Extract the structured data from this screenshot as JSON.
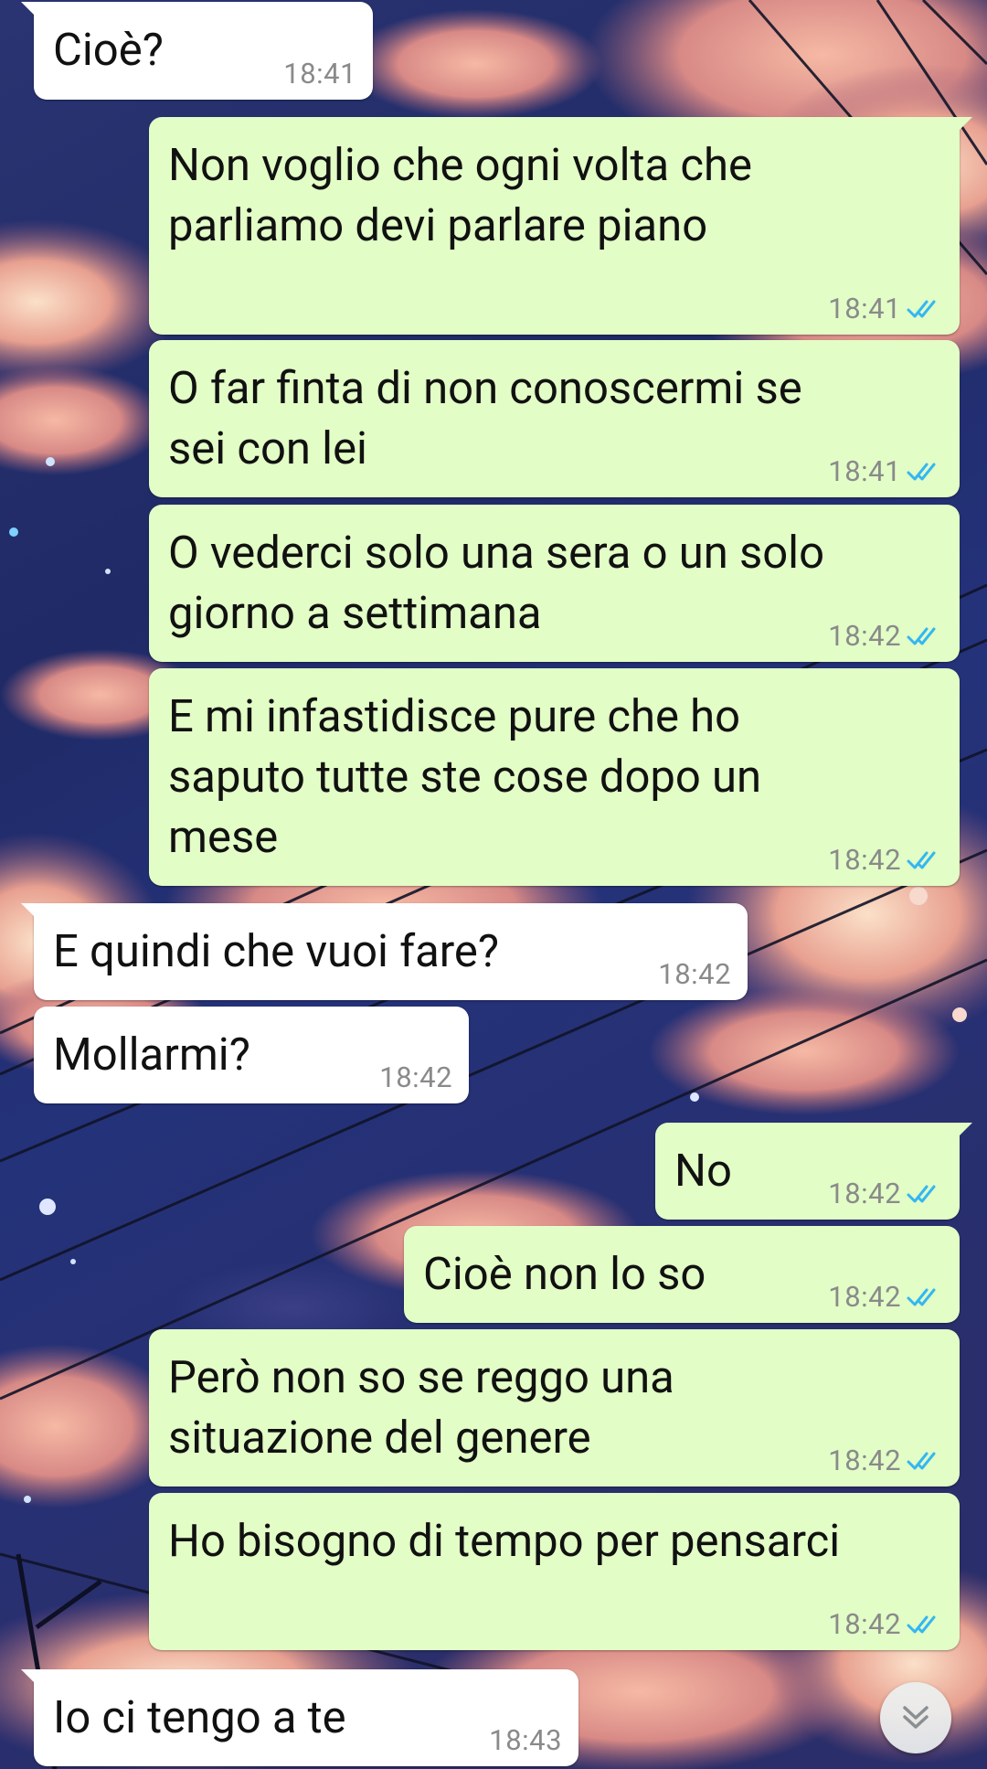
{
  "chat": {
    "messages": [
      {
        "dir": "in",
        "text": "Cioè?",
        "time": "18:41",
        "read": false
      },
      {
        "dir": "out",
        "text": "Non voglio che ogni volta che\nparliamo devi parlare piano",
        "time": "18:41",
        "read": true
      },
      {
        "dir": "out",
        "text": "O far finta di non conoscermi se\nsei con lei",
        "time": "18:41",
        "read": true
      },
      {
        "dir": "out",
        "text": "O vederci solo una sera o un solo\ngiorno a settimana",
        "time": "18:42",
        "read": true
      },
      {
        "dir": "out",
        "text": "E mi infastidisce pure che ho\nsaputo tutte ste cose dopo un\nmese",
        "time": "18:42",
        "read": true
      },
      {
        "dir": "in",
        "text": "E quindi che vuoi fare?",
        "time": "18:42",
        "read": false
      },
      {
        "dir": "in",
        "text": "Mollarmi?",
        "time": "18:42",
        "read": false
      },
      {
        "dir": "out",
        "text": "No",
        "time": "18:42",
        "read": true
      },
      {
        "dir": "out",
        "text": "Cioè non lo so",
        "time": "18:42",
        "read": true
      },
      {
        "dir": "out",
        "text": "Però non so se reggo una\nsituazione del genere",
        "time": "18:42",
        "read": true
      },
      {
        "dir": "out",
        "text": "Ho bisogno di tempo per pensarci",
        "time": "18:42",
        "read": true
      },
      {
        "dir": "in",
        "text": "Io ci tengo a te",
        "time": "18:43",
        "read": false
      }
    ]
  },
  "colors": {
    "incoming_bubble": "#ffffff",
    "outgoing_bubble": "#e2fdc6",
    "read_ticks": "#34b7f1",
    "timestamp": "#8a8a8a",
    "wallpaper_sky": "#1f2a66"
  },
  "icons": {
    "scroll_down": "double-chevron-down-icon",
    "read_receipt": "double-check-icon"
  }
}
